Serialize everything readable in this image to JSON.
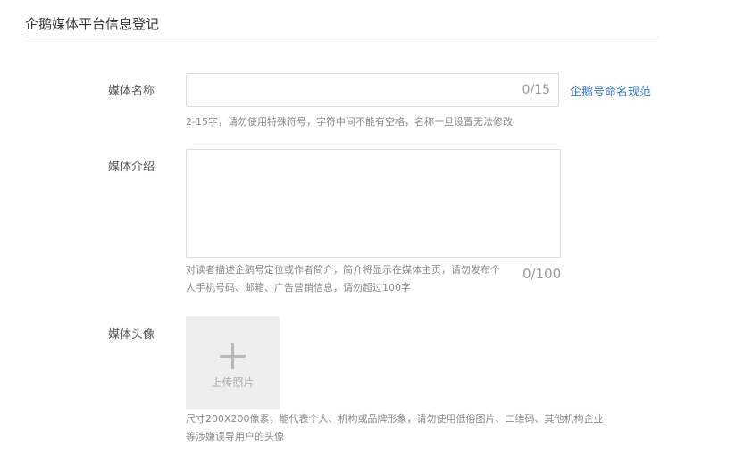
{
  "header": {
    "title": "企鹅媒体平台信息登记"
  },
  "form": {
    "name": {
      "label": "媒体名称",
      "value": "",
      "placeholder": "",
      "counter": "0/15",
      "link": "企鹅号命名规范",
      "hint": "2-15字，请勿使用特殊符号，字符中间不能有空格，名称一旦设置无法修改"
    },
    "intro": {
      "label": "媒体介绍",
      "value": "",
      "placeholder": "",
      "counter": "0/100",
      "hint": "对读者描述企鹅号定位或作者简介，简介将显示在媒体主页，请勿发布个人手机号码、邮箱、广告营销信息，请勿超过100字"
    },
    "avatar": {
      "label": "媒体头像",
      "upload_label": "上传照片",
      "icon": "plus-icon",
      "hint": "尺寸200X200像素，能代表个人、机构或品牌形象，请勿使用低俗图片、二维码、其他机构企业等涉嫌误导用户的头像"
    }
  }
}
